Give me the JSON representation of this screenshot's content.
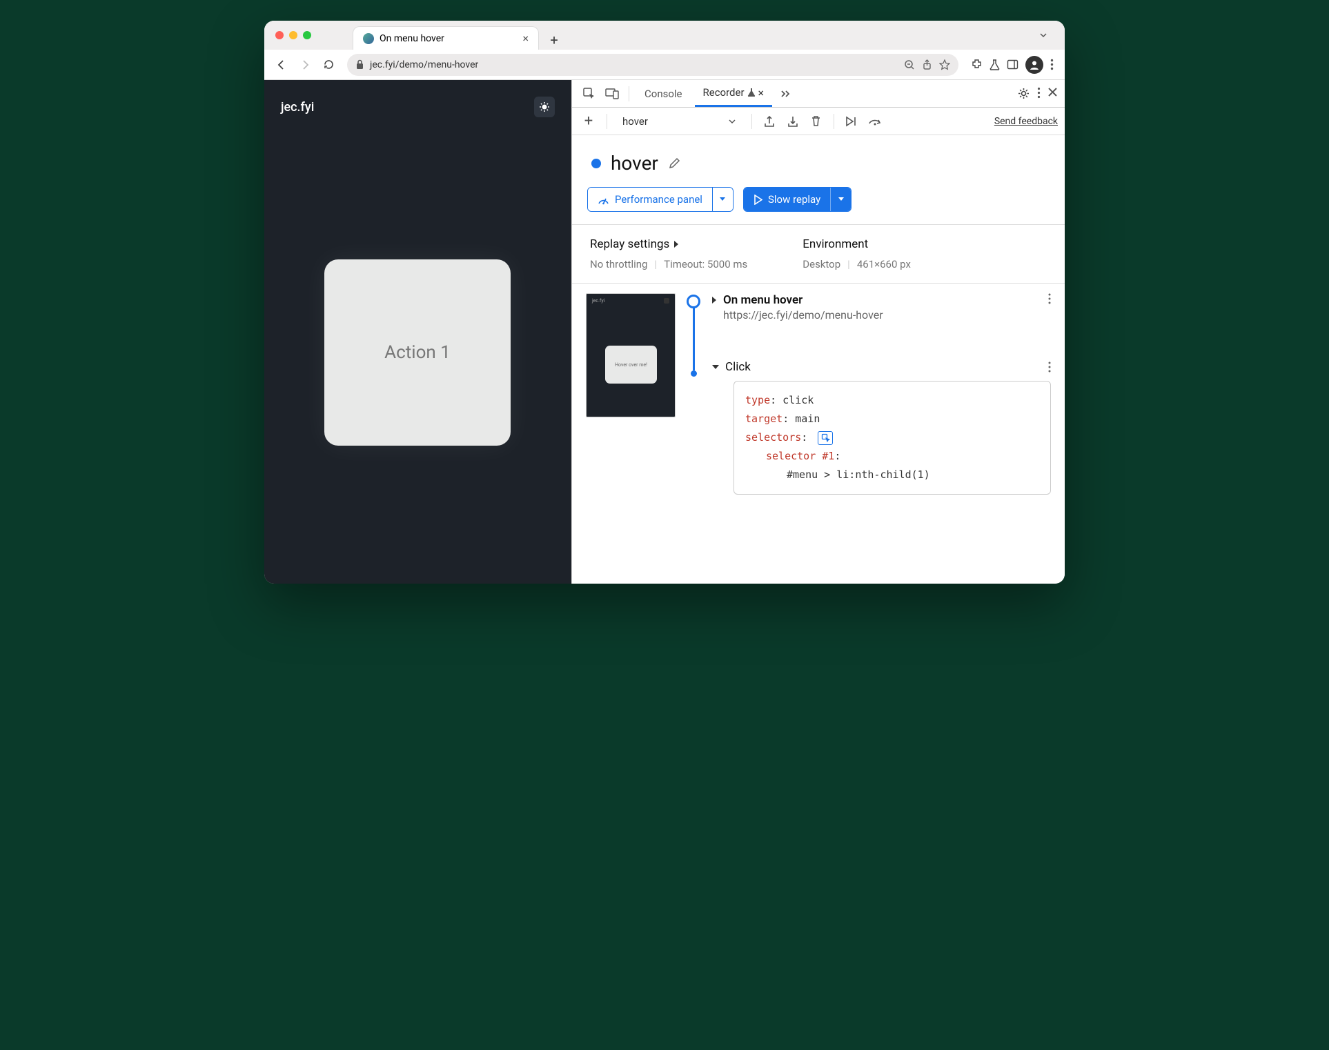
{
  "browserTab": {
    "title": "On menu hover"
  },
  "addressBar": {
    "url": "jec.fyi/demo/menu-hover"
  },
  "page": {
    "siteName": "jec.fyi",
    "cardText": "Action 1"
  },
  "devtools": {
    "tabs": {
      "console": "Console",
      "recorder": "Recorder"
    },
    "toolbar": {
      "flowName": "hover",
      "feedback": "Send feedback"
    },
    "recordingTitle": "hover",
    "buttons": {
      "perf": "Performance panel",
      "replay": "Slow replay"
    },
    "settings": {
      "replayHeader": "Replay settings",
      "throttling": "No throttling",
      "timeout": "Timeout: 5000 ms",
      "envHeader": "Environment",
      "device": "Desktop",
      "dims": "461×660 px"
    },
    "step1": {
      "title": "On menu hover",
      "url": "https://jec.fyi/demo/menu-hover"
    },
    "step2": {
      "label": "Click"
    },
    "thumbText": "Hover over me!",
    "code": {
      "typeKey": "type",
      "typeVal": ": click",
      "targetKey": "target",
      "targetVal": ": main",
      "selectorsKey": "selectors",
      "selectorsColon": ":",
      "selectorLine": "selector #1",
      "selectorColon": ":",
      "cssSelector": "#menu > li:nth-child(1)"
    }
  }
}
